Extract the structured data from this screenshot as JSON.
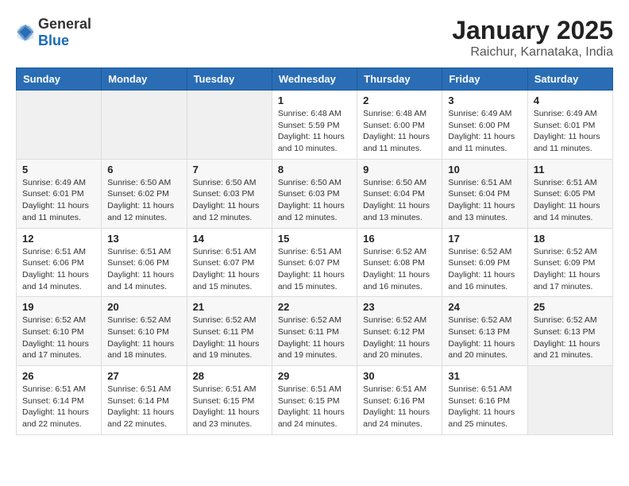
{
  "logo": {
    "general": "General",
    "blue": "Blue"
  },
  "header": {
    "month": "January 2025",
    "location": "Raichur, Karnataka, India"
  },
  "weekdays": [
    "Sunday",
    "Monday",
    "Tuesday",
    "Wednesday",
    "Thursday",
    "Friday",
    "Saturday"
  ],
  "weeks": [
    [
      {
        "day": "",
        "info": ""
      },
      {
        "day": "",
        "info": ""
      },
      {
        "day": "",
        "info": ""
      },
      {
        "day": "1",
        "info": "Sunrise: 6:48 AM\nSunset: 5:59 PM\nDaylight: 11 hours\nand 10 minutes."
      },
      {
        "day": "2",
        "info": "Sunrise: 6:48 AM\nSunset: 6:00 PM\nDaylight: 11 hours\nand 11 minutes."
      },
      {
        "day": "3",
        "info": "Sunrise: 6:49 AM\nSunset: 6:00 PM\nDaylight: 11 hours\nand 11 minutes."
      },
      {
        "day": "4",
        "info": "Sunrise: 6:49 AM\nSunset: 6:01 PM\nDaylight: 11 hours\nand 11 minutes."
      }
    ],
    [
      {
        "day": "5",
        "info": "Sunrise: 6:49 AM\nSunset: 6:01 PM\nDaylight: 11 hours\nand 11 minutes."
      },
      {
        "day": "6",
        "info": "Sunrise: 6:50 AM\nSunset: 6:02 PM\nDaylight: 11 hours\nand 12 minutes."
      },
      {
        "day": "7",
        "info": "Sunrise: 6:50 AM\nSunset: 6:03 PM\nDaylight: 11 hours\nand 12 minutes."
      },
      {
        "day": "8",
        "info": "Sunrise: 6:50 AM\nSunset: 6:03 PM\nDaylight: 11 hours\nand 12 minutes."
      },
      {
        "day": "9",
        "info": "Sunrise: 6:50 AM\nSunset: 6:04 PM\nDaylight: 11 hours\nand 13 minutes."
      },
      {
        "day": "10",
        "info": "Sunrise: 6:51 AM\nSunset: 6:04 PM\nDaylight: 11 hours\nand 13 minutes."
      },
      {
        "day": "11",
        "info": "Sunrise: 6:51 AM\nSunset: 6:05 PM\nDaylight: 11 hours\nand 14 minutes."
      }
    ],
    [
      {
        "day": "12",
        "info": "Sunrise: 6:51 AM\nSunset: 6:06 PM\nDaylight: 11 hours\nand 14 minutes."
      },
      {
        "day": "13",
        "info": "Sunrise: 6:51 AM\nSunset: 6:06 PM\nDaylight: 11 hours\nand 14 minutes."
      },
      {
        "day": "14",
        "info": "Sunrise: 6:51 AM\nSunset: 6:07 PM\nDaylight: 11 hours\nand 15 minutes."
      },
      {
        "day": "15",
        "info": "Sunrise: 6:51 AM\nSunset: 6:07 PM\nDaylight: 11 hours\nand 15 minutes."
      },
      {
        "day": "16",
        "info": "Sunrise: 6:52 AM\nSunset: 6:08 PM\nDaylight: 11 hours\nand 16 minutes."
      },
      {
        "day": "17",
        "info": "Sunrise: 6:52 AM\nSunset: 6:09 PM\nDaylight: 11 hours\nand 16 minutes."
      },
      {
        "day": "18",
        "info": "Sunrise: 6:52 AM\nSunset: 6:09 PM\nDaylight: 11 hours\nand 17 minutes."
      }
    ],
    [
      {
        "day": "19",
        "info": "Sunrise: 6:52 AM\nSunset: 6:10 PM\nDaylight: 11 hours\nand 17 minutes."
      },
      {
        "day": "20",
        "info": "Sunrise: 6:52 AM\nSunset: 6:10 PM\nDaylight: 11 hours\nand 18 minutes."
      },
      {
        "day": "21",
        "info": "Sunrise: 6:52 AM\nSunset: 6:11 PM\nDaylight: 11 hours\nand 19 minutes."
      },
      {
        "day": "22",
        "info": "Sunrise: 6:52 AM\nSunset: 6:11 PM\nDaylight: 11 hours\nand 19 minutes."
      },
      {
        "day": "23",
        "info": "Sunrise: 6:52 AM\nSunset: 6:12 PM\nDaylight: 11 hours\nand 20 minutes."
      },
      {
        "day": "24",
        "info": "Sunrise: 6:52 AM\nSunset: 6:13 PM\nDaylight: 11 hours\nand 20 minutes."
      },
      {
        "day": "25",
        "info": "Sunrise: 6:52 AM\nSunset: 6:13 PM\nDaylight: 11 hours\nand 21 minutes."
      }
    ],
    [
      {
        "day": "26",
        "info": "Sunrise: 6:51 AM\nSunset: 6:14 PM\nDaylight: 11 hours\nand 22 minutes."
      },
      {
        "day": "27",
        "info": "Sunrise: 6:51 AM\nSunset: 6:14 PM\nDaylight: 11 hours\nand 22 minutes."
      },
      {
        "day": "28",
        "info": "Sunrise: 6:51 AM\nSunset: 6:15 PM\nDaylight: 11 hours\nand 23 minutes."
      },
      {
        "day": "29",
        "info": "Sunrise: 6:51 AM\nSunset: 6:15 PM\nDaylight: 11 hours\nand 24 minutes."
      },
      {
        "day": "30",
        "info": "Sunrise: 6:51 AM\nSunset: 6:16 PM\nDaylight: 11 hours\nand 24 minutes."
      },
      {
        "day": "31",
        "info": "Sunrise: 6:51 AM\nSunset: 6:16 PM\nDaylight: 11 hours\nand 25 minutes."
      },
      {
        "day": "",
        "info": ""
      }
    ]
  ]
}
